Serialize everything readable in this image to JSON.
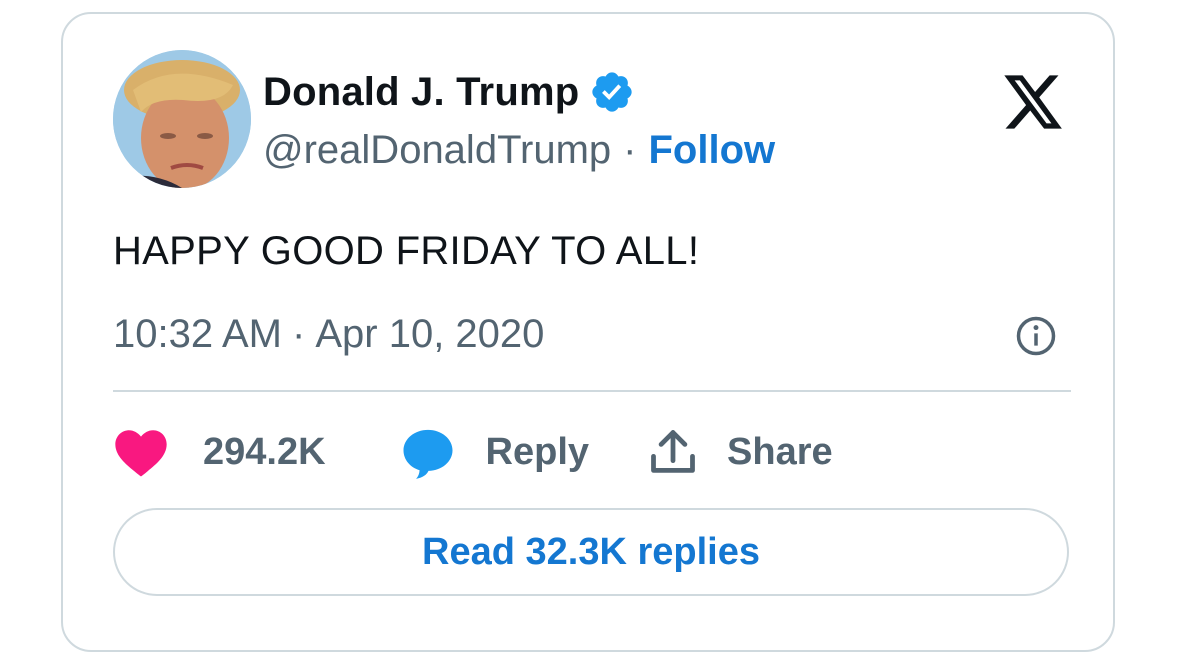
{
  "author": {
    "display_name": "Donald J. Trump",
    "handle": "@realDonaldTrump",
    "verified": true,
    "avatar": "profile-photo"
  },
  "header": {
    "separator": "·",
    "follow_label": "Follow",
    "platform_logo": "x-logo-icon"
  },
  "tweet": {
    "text": "HAPPY GOOD FRIDAY TO ALL!",
    "time": "10:32 AM",
    "date": "Apr 10, 2020"
  },
  "actions": {
    "like_count": "294.2K",
    "reply_label": "Reply",
    "share_label": "Share"
  },
  "footer": {
    "read_replies_label": "Read 32.3K replies"
  },
  "colors": {
    "link_blue": "#1477d1",
    "verified_blue": "#1d9bf0",
    "like_pink": "#f91880",
    "reply_blue": "#1d9bf0",
    "text_primary": "#0f1419",
    "text_secondary": "#536471",
    "border": "#cfd9de"
  }
}
